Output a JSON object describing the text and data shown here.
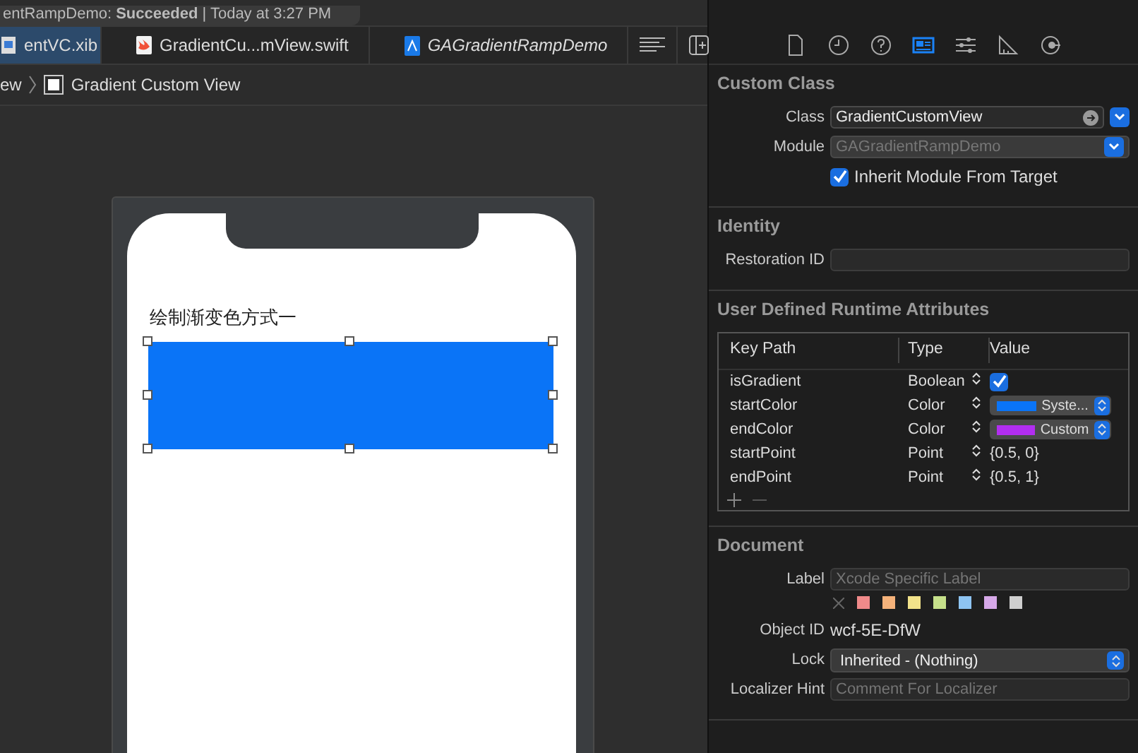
{
  "activity": {
    "text": "entRampDemo: **Succeeded** | Today at 3:27 PM"
  },
  "tabs": [
    {
      "label": "entVC.xib",
      "kind": "xib",
      "selected": true,
      "preview": false
    },
    {
      "label": "GradientCu...mView.swift",
      "kind": "swift",
      "selected": false,
      "preview": false
    },
    {
      "label": "GAGradientRampDemo",
      "kind": "project",
      "selected": false,
      "preview": true
    }
  ],
  "breadcrumb": [
    {
      "label": "ew",
      "kind": "text"
    },
    {
      "label": "Gradient Custom View",
      "kind": "view"
    }
  ],
  "canvas": {
    "label": "绘制渐变色方式一"
  },
  "inspector_tabs": [
    {
      "kind": "file",
      "selected": false
    },
    {
      "kind": "history",
      "selected": false
    },
    {
      "kind": "help",
      "selected": false
    },
    {
      "kind": "identity",
      "selected": true
    },
    {
      "kind": "attributes",
      "selected": false
    },
    {
      "kind": "size",
      "selected": false
    },
    {
      "kind": "connections",
      "selected": false
    }
  ],
  "custom_class": {
    "title": "Custom Class",
    "class_label": "Class",
    "class_value": "GradientCustomView",
    "module_label": "Module",
    "module_placeholder": "GAGradientRampDemo",
    "inherit_label": "Inherit Module From Target",
    "inherit_checked": true
  },
  "identity": {
    "title": "Identity",
    "restoration_label": "Restoration ID"
  },
  "runtime_attributes": {
    "title": "User Defined Runtime Attributes",
    "columns": [
      "Key Path",
      "Type",
      "Value"
    ],
    "rows": [
      {
        "key": "isGradient",
        "type": "Boolean",
        "kind": "checkbox",
        "checked": true
      },
      {
        "key": "startColor",
        "type": "Color",
        "kind": "color",
        "color": "#0a74f7",
        "value": "Syste..."
      },
      {
        "key": "endColor",
        "type": "Color",
        "kind": "color",
        "color": "#b22ef0",
        "value": "Custom"
      },
      {
        "key": "startPoint",
        "type": "Point",
        "kind": "text",
        "value": "{0.5, 0}"
      },
      {
        "key": "endPoint",
        "type": "Point",
        "kind": "text",
        "value": "{0.5, 1}"
      }
    ]
  },
  "document": {
    "title": "Document",
    "label_label": "Label",
    "label_placeholder": "Xcode Specific Label",
    "swatches": [
      {
        "color": "#f08a8a"
      },
      {
        "color": "#f5b27a"
      },
      {
        "color": "#f2e28a"
      },
      {
        "color": "#c6e08a"
      },
      {
        "color": "#8ec4f2"
      },
      {
        "color": "#d6a8e8"
      },
      {
        "color": "#cfcfcf"
      }
    ],
    "object_id_label": "Object ID",
    "object_id": "wcf-5E-DfW",
    "lock_label": "Lock",
    "lock_value": "Inherited - (Nothing)",
    "hint_label": "Localizer Hint",
    "hint_placeholder": "Comment For Localizer"
  }
}
